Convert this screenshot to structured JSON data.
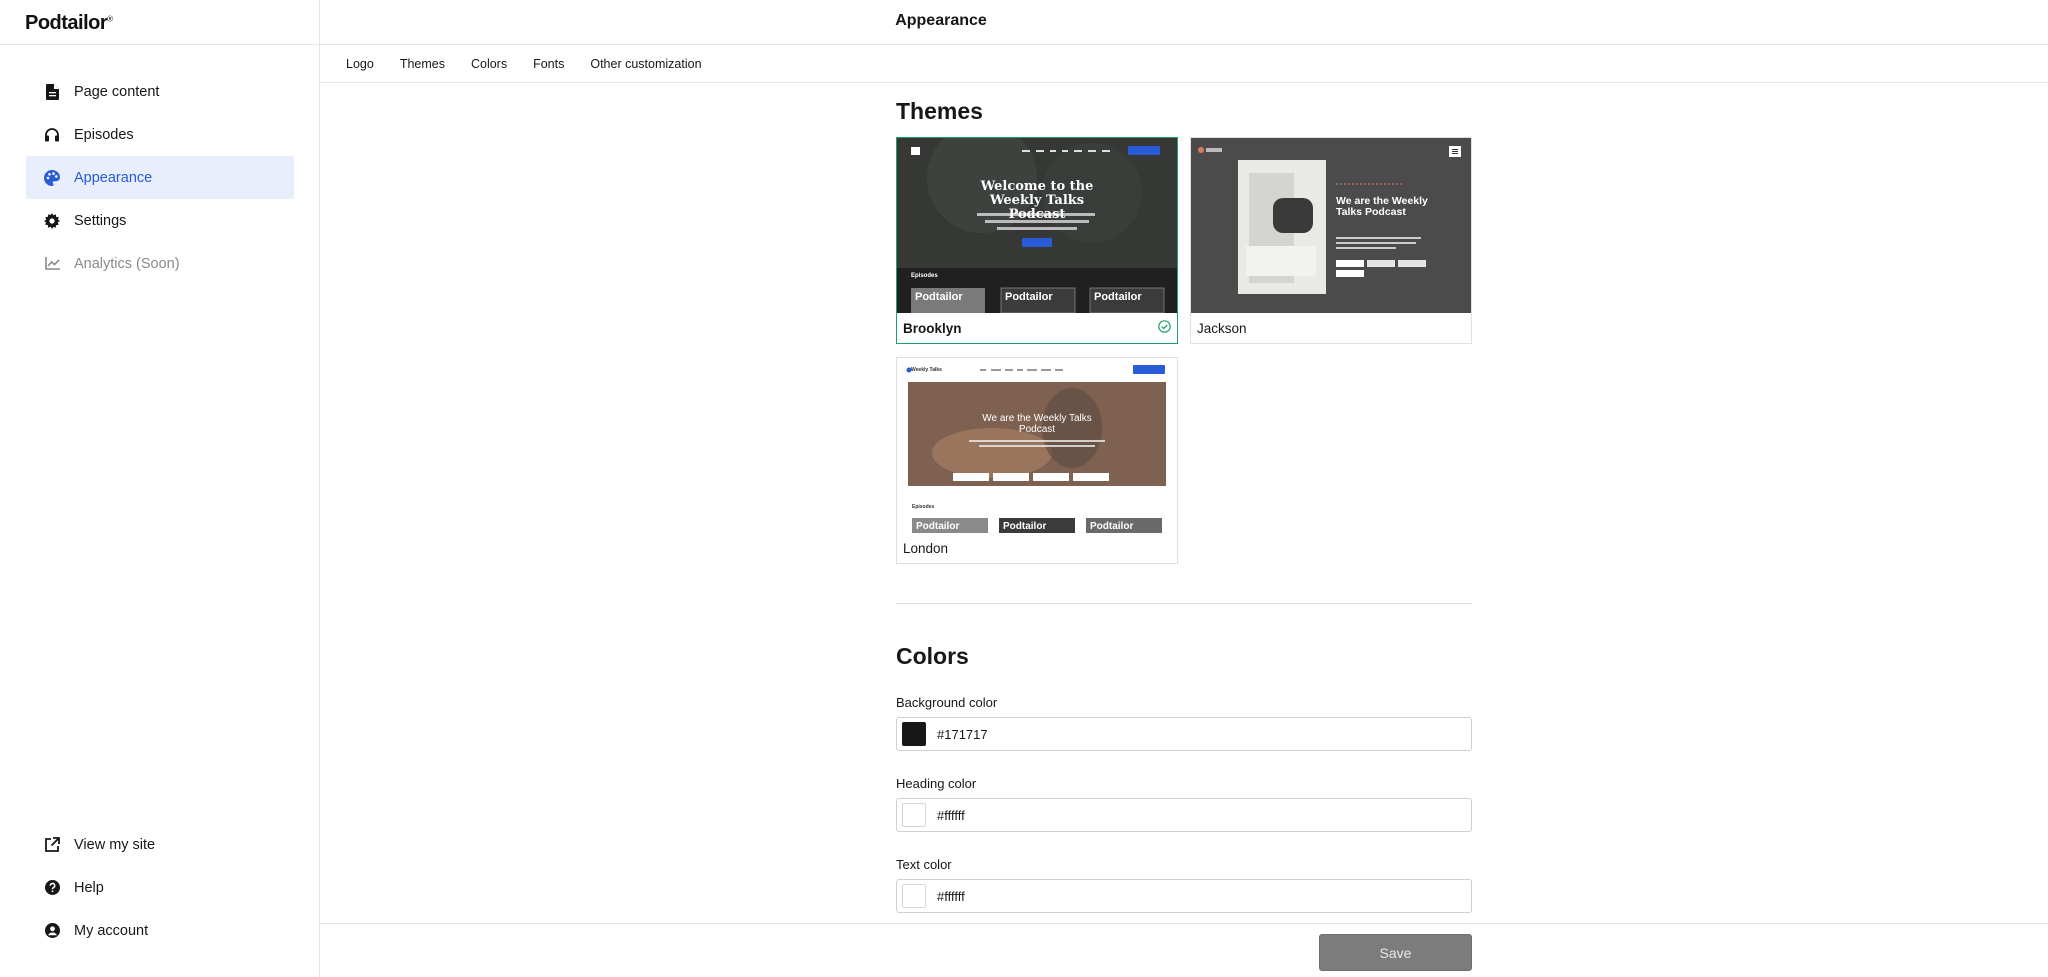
{
  "app": {
    "logo": "Podtailor",
    "logo_mark": "®"
  },
  "header": {
    "title": "Appearance"
  },
  "sidebar": {
    "items": [
      {
        "label": "Page content",
        "icon": "document-icon"
      },
      {
        "label": "Episodes",
        "icon": "headphones-icon"
      },
      {
        "label": "Appearance",
        "icon": "palette-icon",
        "active": true
      },
      {
        "label": "Settings",
        "icon": "gear-icon"
      },
      {
        "label": "Analytics (Soon)",
        "icon": "chart-line-icon",
        "disabled": true
      }
    ],
    "bottom": [
      {
        "label": "View my site",
        "icon": "external-link-icon"
      },
      {
        "label": "Help",
        "icon": "help-icon"
      },
      {
        "label": "My account",
        "icon": "account-icon"
      }
    ]
  },
  "tabs": [
    "Logo",
    "Themes",
    "Colors",
    "Fonts",
    "Other customization"
  ],
  "themes": {
    "title": "Themes",
    "items": [
      {
        "name": "Brooklyn",
        "selected": true,
        "preview_headline": "Welcome to the Weekly Talks Podcast",
        "preview_section": "Episodes",
        "preview_brand": "Podtailor"
      },
      {
        "name": "Jackson",
        "selected": false,
        "preview_headline": "We are the Weekly Talks Podcast"
      },
      {
        "name": "London",
        "selected": false,
        "preview_headline": "We are the Weekly Talks Podcast",
        "preview_brand_top": "Weekly Talks",
        "preview_section": "Episodes",
        "preview_brand": "Podtailor"
      }
    ]
  },
  "colors": {
    "title": "Colors",
    "fields": [
      {
        "label": "Background color",
        "value": "#171717",
        "swatch": "#171717"
      },
      {
        "label": "Heading color",
        "value": "#ffffff",
        "swatch": "#ffffff"
      },
      {
        "label": "Text color",
        "value": "#ffffff",
        "swatch": "#ffffff"
      }
    ]
  },
  "footer": {
    "save_label": "Save"
  },
  "palette": {
    "accent": "#2a5bd7",
    "active_bg": "#e8eefc",
    "selected_border": "#22a06b",
    "save_bg": "#7c7c7c"
  }
}
